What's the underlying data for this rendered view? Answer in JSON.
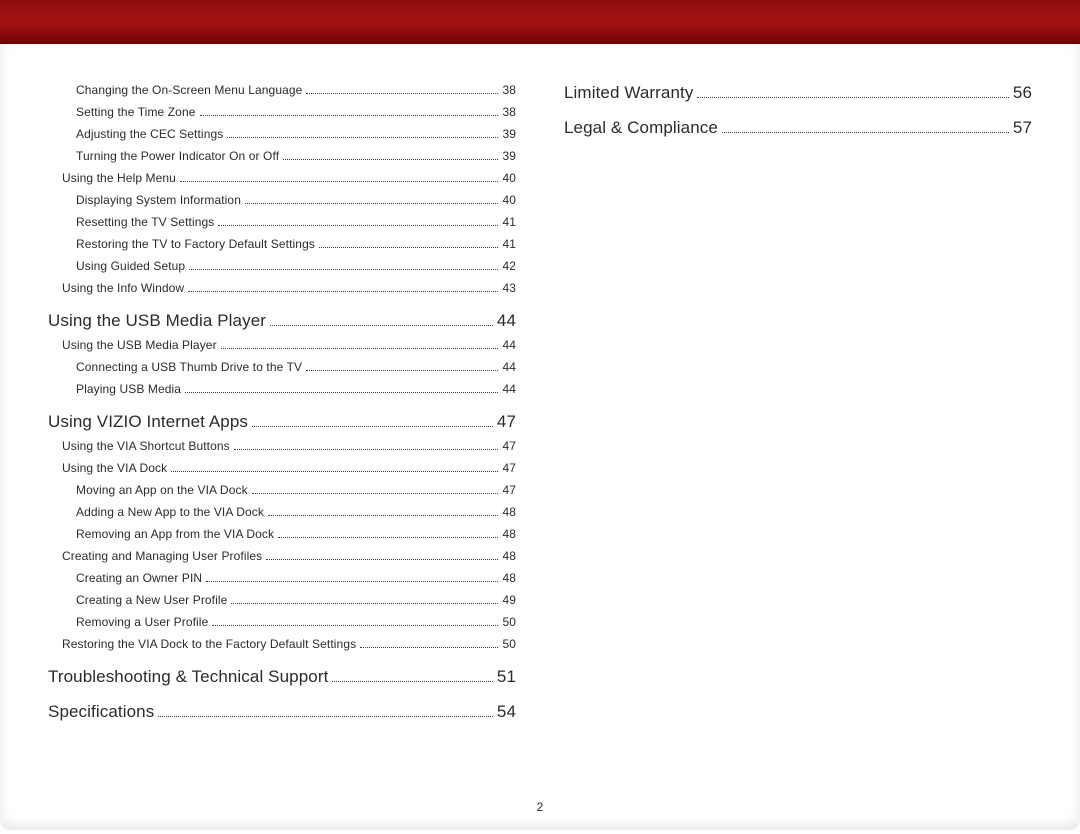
{
  "page_number": "2",
  "columns": [
    [
      {
        "level": 2,
        "label": "Changing the On-Screen Menu Language",
        "page": "38"
      },
      {
        "level": 2,
        "label": "Setting the Time Zone",
        "page": "38"
      },
      {
        "level": 2,
        "label": "Adjusting the CEC Settings",
        "page": "39"
      },
      {
        "level": 2,
        "label": "Turning the Power Indicator On or Off",
        "page": "39"
      },
      {
        "level": 1,
        "label": "Using the Help Menu",
        "page": "40"
      },
      {
        "level": 2,
        "label": "Displaying System Information",
        "page": "40"
      },
      {
        "level": 2,
        "label": "Resetting the TV Settings",
        "page": "41"
      },
      {
        "level": 2,
        "label": "Restoring the TV to Factory Default Settings",
        "page": "41"
      },
      {
        "level": 2,
        "label": "Using Guided Setup",
        "page": "42"
      },
      {
        "level": 1,
        "label": "Using the Info Window",
        "page": "43"
      },
      {
        "level": 0,
        "label": "Using the USB Media Player",
        "page": "44"
      },
      {
        "level": 1,
        "label": "Using the USB Media Player",
        "page": "44"
      },
      {
        "level": 2,
        "label": "Connecting a USB Thumb Drive to the TV",
        "page": "44"
      },
      {
        "level": 2,
        "label": "Playing USB Media",
        "page": "44"
      },
      {
        "level": 0,
        "label": "Using VIZIO Internet Apps",
        "page": "47"
      },
      {
        "level": 1,
        "label": "Using the VIA Shortcut Buttons",
        "page": "47"
      },
      {
        "level": 1,
        "label": "Using the VIA Dock",
        "page": "47"
      },
      {
        "level": 2,
        "label": "Moving an App on the VIA Dock",
        "page": "47"
      },
      {
        "level": 2,
        "label": "Adding a New App to the VIA Dock",
        "page": "48"
      },
      {
        "level": 2,
        "label": "Removing an App from the VIA Dock",
        "page": "48"
      },
      {
        "level": 1,
        "label": "Creating and Managing User Profiles",
        "page": "48"
      },
      {
        "level": 2,
        "label": "Creating an Owner PIN",
        "page": "48"
      },
      {
        "level": 2,
        "label": "Creating a New User Profile",
        "page": "49"
      },
      {
        "level": 2,
        "label": "Removing a User Profile",
        "page": "50"
      },
      {
        "level": 1,
        "label": "Restoring the VIA Dock to the Factory Default Settings",
        "page": "50"
      },
      {
        "level": 0,
        "label": "Troubleshooting & Technical Support",
        "page": "51"
      },
      {
        "level": 0,
        "label": "Specifications",
        "page": "54"
      }
    ],
    [
      {
        "level": 0,
        "label": "Limited Warranty",
        "page": "56",
        "first": true
      },
      {
        "level": 0,
        "label": "Legal & Compliance",
        "page": "57"
      }
    ]
  ]
}
